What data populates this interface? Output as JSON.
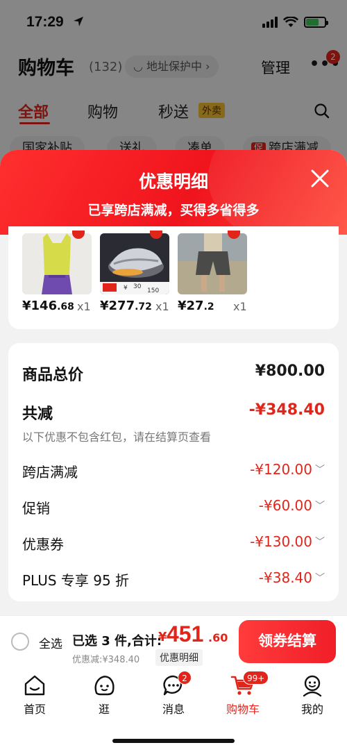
{
  "status": {
    "time": "17:29"
  },
  "header": {
    "title": "购物车",
    "count": "(132)",
    "address": "◡ 地址保护中 ›",
    "manage": "管理",
    "more_badge": "2"
  },
  "tabs": [
    {
      "label": "全部"
    },
    {
      "label": "购物"
    },
    {
      "label": "秒送"
    }
  ],
  "tab_tag": "外卖",
  "chips": [
    {
      "label": "国家补贴"
    },
    {
      "label": "送礼"
    },
    {
      "label": "凑单"
    },
    {
      "label": "跨店满减",
      "badge": "促"
    }
  ],
  "sheet": {
    "title": "优惠明细",
    "subtitle": "已享跨店满减，买得多省得多",
    "products": [
      {
        "price_int": "¥146",
        "price_dec": ".68",
        "qty": "x1"
      },
      {
        "price_int": "¥277",
        "price_dec": ".72",
        "qty": "x1"
      },
      {
        "price_int": "¥27",
        "price_dec": ".2",
        "qty": "x1"
      }
    ],
    "shoe_tags": [
      "¥",
      "30",
      "150"
    ],
    "summary": {
      "total_label": "商品总价",
      "total_value": "¥800.00",
      "reduce_label": "共减",
      "reduce_value": "-¥348.40",
      "note": "以下优惠不包含红包，请在结算页查看",
      "items": [
        {
          "label": "跨店满减",
          "value": "-¥120.00"
        },
        {
          "label": "促销",
          "value": "-¥60.00"
        },
        {
          "label": "优惠券",
          "value": "-¥130.00"
        },
        {
          "label": "PLUS 专享 95 折",
          "value": "-¥38.40"
        }
      ]
    }
  },
  "checkout": {
    "select_all": "全选",
    "selected": "已选 3 件,合计:",
    "yen": "¥",
    "total_int": "451",
    "total_dec": ".60",
    "discount": "优惠减:¥348.40",
    "detail": "优惠明细",
    "pay": "领券结算"
  },
  "tabbar": [
    {
      "label": "首页",
      "icon": "home-icon"
    },
    {
      "label": "逛",
      "icon": "browse-face-icon"
    },
    {
      "label": "消息",
      "icon": "message-icon",
      "badge": "2"
    },
    {
      "label": "购物车",
      "icon": "cart-icon",
      "badge": "99+"
    },
    {
      "label": "我的",
      "icon": "profile-icon"
    }
  ],
  "colors": {
    "accent": "#e1251b",
    "tag_yellow": "#f4c02e"
  }
}
